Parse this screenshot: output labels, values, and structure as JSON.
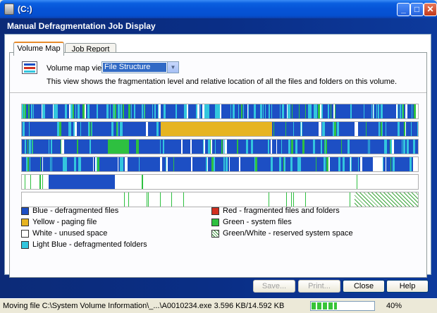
{
  "window": {
    "title": "(C:)"
  },
  "header": {
    "title": "Manual Defragmentation Job Display"
  },
  "tabs": [
    {
      "label": "Volume Map"
    },
    {
      "label": "Job Report"
    }
  ],
  "view": {
    "label": "Volume map view:",
    "selected": "File Structure",
    "description": "This view shows the fragmentation level and relative location of all the files and folders on this volume."
  },
  "colors": {
    "blue": "#1d4fc4",
    "yellow": "#e6b422",
    "white": "#ffffff",
    "lightblue": "#33c6de",
    "red": "#d23020",
    "green": "#2ec040"
  },
  "legend": [
    {
      "label": "Blue - defragmented files",
      "swatch": "#1d4fc4"
    },
    {
      "label": "Yellow - paging file",
      "swatch": "#e6b422"
    },
    {
      "label": "White - unused space",
      "swatch": "#ffffff"
    },
    {
      "label": "Light Blue - defragmented folders",
      "swatch": "#33c6de"
    },
    {
      "label": "Red - fragmented files and folders",
      "swatch": "#d23020"
    },
    {
      "label": "Green - system files",
      "swatch": "#2ec040"
    },
    {
      "label": "Green/White - reserved system space",
      "swatch": "hatch"
    }
  ],
  "buttons": {
    "save": "Save...",
    "print": "Print...",
    "close": "Close",
    "help": "Help"
  },
  "status": {
    "text": "Moving file C:\\System Volume Information\\_...\\A0010234.exe  3.596 KB/14.592 KB",
    "progress": 0.4,
    "percent": "40%"
  }
}
